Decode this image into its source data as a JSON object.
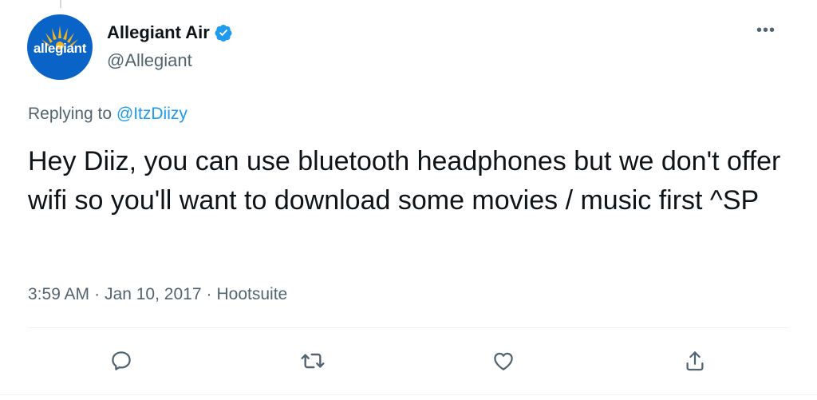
{
  "author": {
    "display_name": "Allegiant Air",
    "handle": "@Allegiant",
    "avatar_text": "allegiant",
    "verified": true
  },
  "reply": {
    "prefix": "Replying to",
    "mention": "@ItzDiizy"
  },
  "tweet": {
    "text": "Hey Diiz, you can use bluetooth headphones but we don't offer wifi so you'll want to download some movies / music first ^SP"
  },
  "meta": {
    "time": "3:59 AM",
    "date": "Jan 10, 2017",
    "source": "Hootsuite",
    "separator": "·"
  },
  "more_label": "•••",
  "actions": [
    {
      "name": "reply",
      "icon": "comment-icon"
    },
    {
      "name": "retweet",
      "icon": "retweet-icon"
    },
    {
      "name": "like",
      "icon": "heart-icon"
    },
    {
      "name": "share",
      "icon": "share-icon"
    }
  ],
  "colors": {
    "text": "#0f1419",
    "secondary": "#536471",
    "link": "#1d9bf0",
    "avatar_bg": "#0a64c8",
    "sun": "#f5b21b"
  }
}
